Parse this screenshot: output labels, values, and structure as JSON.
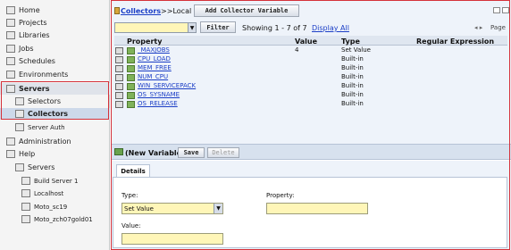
{
  "sidebar": {
    "items": [
      {
        "label": "Home"
      },
      {
        "label": "Projects"
      },
      {
        "label": "Libraries"
      },
      {
        "label": "Jobs"
      },
      {
        "label": "Schedules"
      },
      {
        "label": "Environments"
      },
      {
        "label": "Servers"
      },
      {
        "label": "Selectors"
      },
      {
        "label": "Collectors"
      },
      {
        "label": "Server Auth"
      },
      {
        "label": "Administration"
      },
      {
        "label": "Help"
      }
    ],
    "servers_heading": "Servers",
    "servers": [
      {
        "label": "Build Server 1"
      },
      {
        "label": "Localhost"
      },
      {
        "label": "Moto_sc19"
      },
      {
        "label": "Moto_zch07gold01"
      }
    ]
  },
  "breadcrumb": {
    "link": "Collectors",
    "rest": ">>Local"
  },
  "add_button": "Add Collector Variable",
  "filter_button": "Filter",
  "showing": "Showing 1 - 7 of 7",
  "display_all": "Display All",
  "page_label": "Page",
  "table": {
    "headers": [
      "Property",
      "Value",
      "Type",
      "Regular Expression"
    ],
    "rows": [
      {
        "name": "_MAXJOBS",
        "value": "4",
        "type": "Set Value"
      },
      {
        "name": "CPU_LOAD",
        "value": "",
        "type": "Built-in"
      },
      {
        "name": "MEM_FREE",
        "value": "",
        "type": "Built-in"
      },
      {
        "name": "NUM_CPU",
        "value": "",
        "type": "Built-in"
      },
      {
        "name": "WIN_SERVICEPACK",
        "value": "",
        "type": "Built-in"
      },
      {
        "name": "OS_SYSNAME",
        "value": "",
        "type": "Built-in"
      },
      {
        "name": "OS_RELEASE",
        "value": "",
        "type": "Built-in"
      }
    ]
  },
  "detail": {
    "title": "(New Variable)",
    "save": "Save",
    "delete": "Delete",
    "tab": "Details",
    "type_label": "Type:",
    "type_value": "Set Value",
    "property_label": "Property:",
    "value_label": "Value:"
  }
}
